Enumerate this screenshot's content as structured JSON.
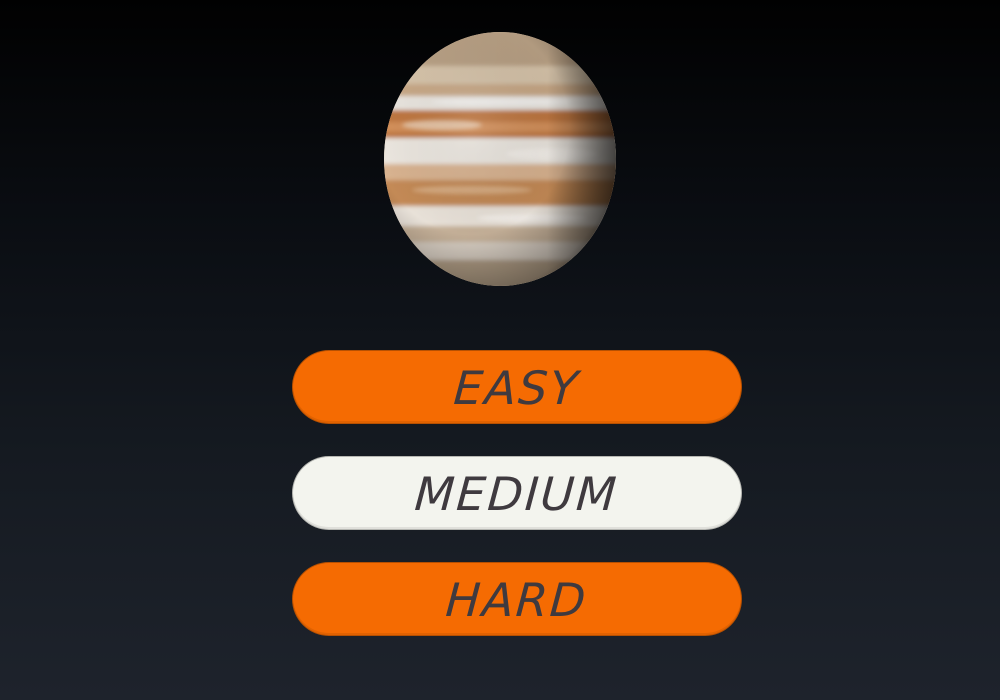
{
  "planet": {
    "name_icon": "jupiter-planet-image"
  },
  "menu": {
    "buttons": [
      {
        "id": "easy",
        "label": "EASY",
        "color": "#f56b02",
        "selected": false
      },
      {
        "id": "medium",
        "label": "MEDIUM",
        "color": "#f3f4ee",
        "selected": true
      },
      {
        "id": "hard",
        "label": "HARD",
        "color": "#f56b02",
        "selected": false
      }
    ]
  },
  "theme": {
    "background_top": "#010101",
    "background_bottom": "#1e232c",
    "text_color": "#3f3a3f"
  }
}
